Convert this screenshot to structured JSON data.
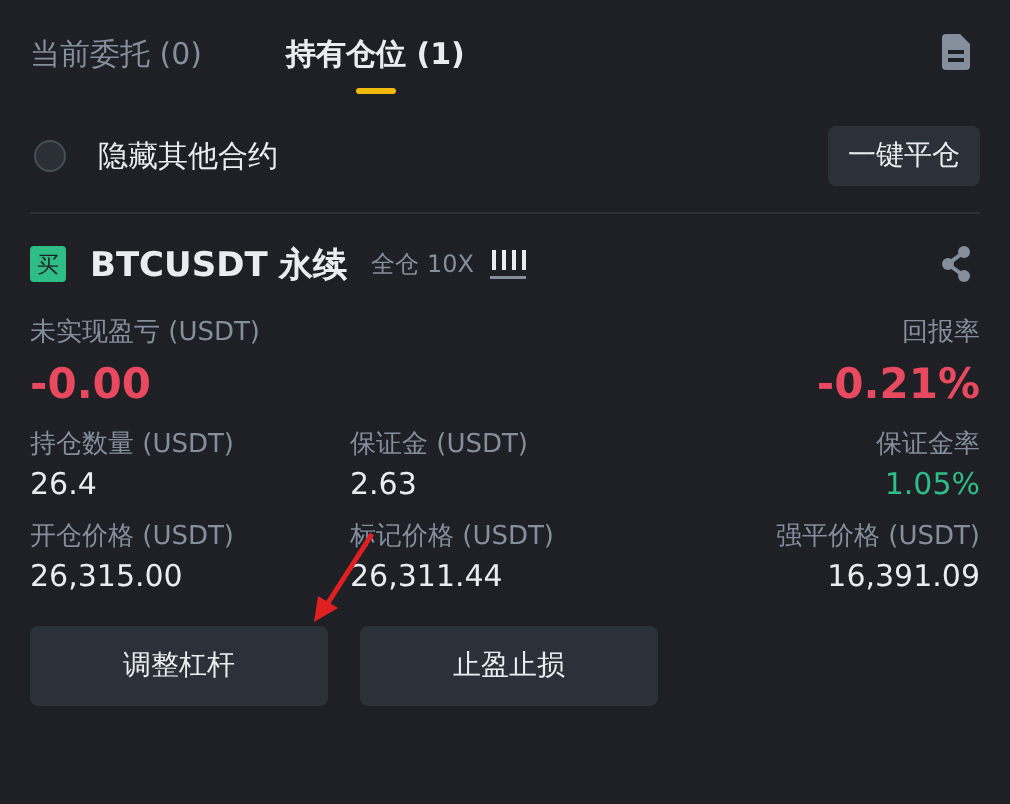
{
  "tabs": [
    {
      "label": "当前委托 (0)",
      "selected": false
    },
    {
      "label": "持有仓位 (1)",
      "selected": true
    }
  ],
  "hide_others": {
    "label": "隐藏其他合约",
    "checked": false
  },
  "close_all_button": "一键平仓",
  "position": {
    "side_badge": "买",
    "symbol": "BTCUSDT 永续",
    "margin_mode": "全仓 10X",
    "headline": [
      {
        "label": "未实现盈亏 (USDT)",
        "value": "-0.00",
        "color": "#e8495f"
      },
      {
        "label": "回报率",
        "value": "-0.21%",
        "color": "#e8495f"
      }
    ],
    "details": [
      {
        "label": "持仓数量 (USDT)",
        "value": "26.4",
        "color": "#eaecef"
      },
      {
        "label": "保证金 (USDT)",
        "value": "2.63",
        "color": "#eaecef"
      },
      {
        "label": "保证金率",
        "value": "1.05%",
        "color": "#2ebd85"
      },
      {
        "label": "开仓价格 (USDT)",
        "value": "26,315.00",
        "color": "#eaecef"
      },
      {
        "label": "标记价格 (USDT)",
        "value": "26,311.44",
        "color": "#eaecef"
      },
      {
        "label": "强平价格 (USDT)",
        "value": "16,391.09",
        "color": "#eaecef"
      }
    ]
  },
  "buttons": [
    "调整杠杆",
    "止盈止损"
  ]
}
